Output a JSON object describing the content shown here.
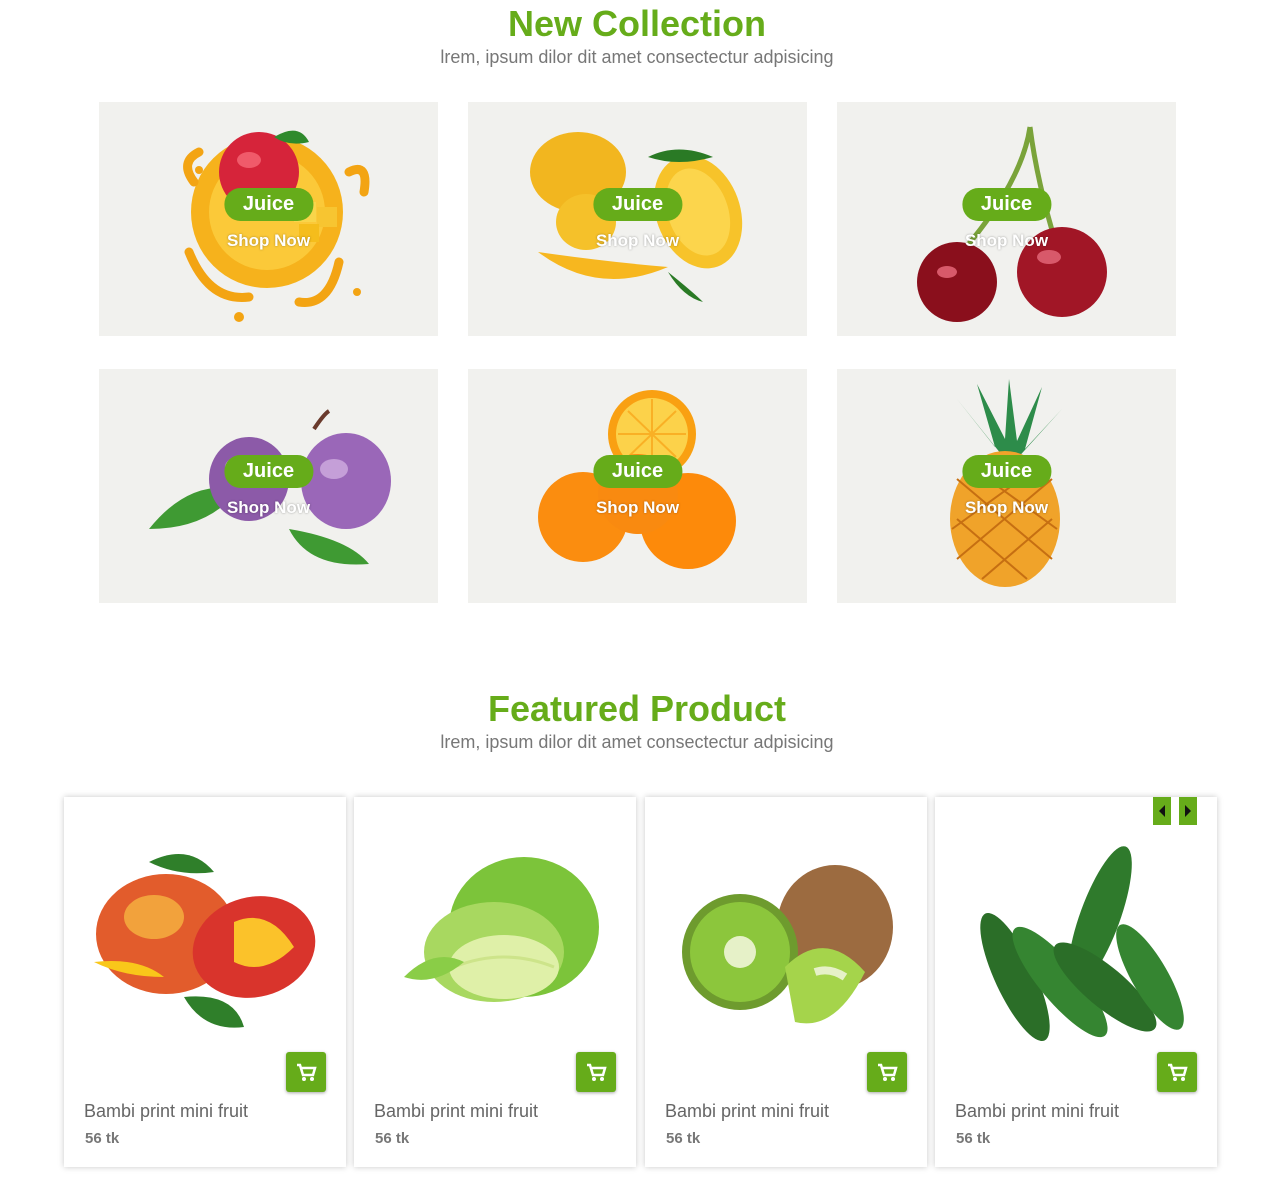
{
  "new_collection": {
    "title": "New Collection",
    "subtitle": "lrem, ipsum dilor dit amet consectectur adpisicing",
    "cards": [
      {
        "badge": "Juice",
        "link": "Shop Now",
        "fruit": "mango-juice-splash"
      },
      {
        "badge": "Juice",
        "link": "Shop Now",
        "fruit": "mangoes"
      },
      {
        "badge": "Juice",
        "link": "Shop Now",
        "fruit": "cherries"
      },
      {
        "badge": "Juice",
        "link": "Shop Now",
        "fruit": "plums"
      },
      {
        "badge": "Juice",
        "link": "Shop Now",
        "fruit": "oranges"
      },
      {
        "badge": "Juice",
        "link": "Shop Now",
        "fruit": "pineapple"
      }
    ]
  },
  "featured": {
    "title": "Featured Product",
    "subtitle": "lrem, ipsum dilor dit amet consectectur adpisicing",
    "products": [
      {
        "name": "Bambi print mini fruit",
        "price": "56 tk",
        "image": "mango"
      },
      {
        "name": "Bambi print mini fruit",
        "price": "56 tk",
        "image": "chinese-cabbage"
      },
      {
        "name": "Bambi print mini fruit",
        "price": "56 tk",
        "image": "kiwi"
      },
      {
        "name": "Bambi print mini fruit",
        "price": "56 tk",
        "image": "cucumbers"
      }
    ],
    "prev_icon": "caret-left-icon",
    "next_icon": "caret-right-icon",
    "cart_icon": "shopping-cart-icon"
  },
  "colors": {
    "accent": "#66ac1a",
    "card_bg": "#f1f1ee",
    "text": "#666666"
  }
}
